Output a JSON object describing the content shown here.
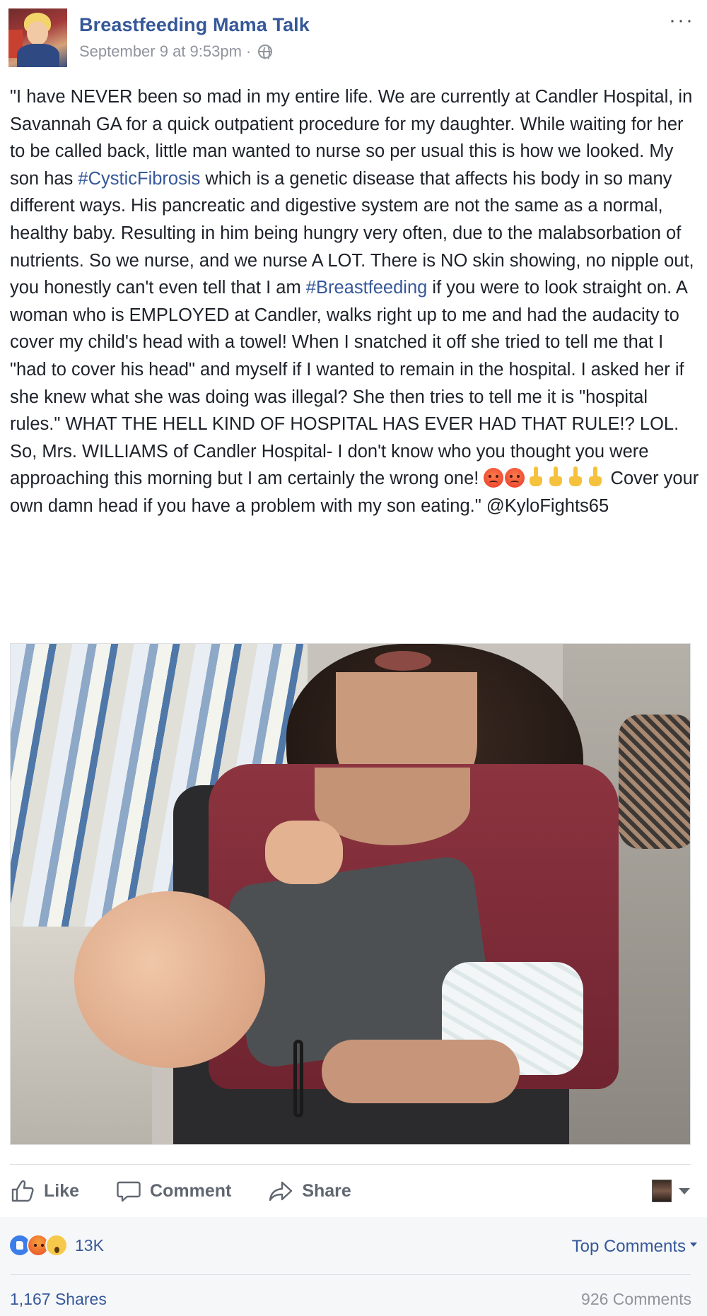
{
  "post": {
    "page_name": "Breastfeeding Mama Talk",
    "timestamp": "September 9 at 9:53pm",
    "separator": "·",
    "privacy_icon": "globe-icon",
    "more_icon": "ellipsis-icon",
    "text_segments": [
      {
        "type": "text",
        "value": "\"I have NEVER been so mad in my entire life. We are currently at Candler Hospital, in Savannah GA for a quick outpatient procedure for my daughter. While waiting for her to be called back, little man wanted to nurse so per usual this is how we looked. My son has "
      },
      {
        "type": "tag",
        "value": "#CysticFibrosis"
      },
      {
        "type": "text",
        "value": " which is a genetic disease that affects his body in so many different ways. His pancreatic and digestive system are not the same as a normal, healthy baby. Resulting in him being hungry very often, due to the malabsorbation of nutrients. So we nurse, and we nurse A LOT. There is NO skin showing, no nipple out, you honestly can't even tell that I am "
      },
      {
        "type": "tag",
        "value": "#Breastfeeding"
      },
      {
        "type": "text",
        "value": " if you were to look straight on. A woman who is EMPLOYED at Candler, walks right up to me and had the audacity to cover my child's head with a towel! When I snatched it off she tried to tell me that I \"had to cover his head\" and myself if I wanted to remain in the hospital. I asked her if she knew what she was doing was illegal? She then tries to tell me it is \"hospital rules.\" WHAT THE HELL KIND OF HOSPITAL HAS EVER HAD THAT RULE!? LOL. So, Mrs. WILLIAMS of Candler Hospital- I don't know who you thought you were approaching this morning but I am certainly the wrong one! "
      },
      {
        "type": "emoji",
        "value": "angry-face-emoji"
      },
      {
        "type": "emoji",
        "value": "angry-face-emoji"
      },
      {
        "type": "emoji",
        "value": "middle-finger-emoji"
      },
      {
        "type": "emoji",
        "value": "middle-finger-emoji"
      },
      {
        "type": "emoji",
        "value": "middle-finger-emoji"
      },
      {
        "type": "emoji",
        "value": "middle-finger-emoji"
      },
      {
        "type": "text",
        "value": " Cover your own damn head if you have a problem with my son eating.\" @KyloFights65"
      }
    ]
  },
  "actions": {
    "like_label": "Like",
    "comment_label": "Comment",
    "share_label": "Share"
  },
  "summary": {
    "reaction_icons": [
      "like",
      "angry",
      "wow"
    ],
    "reaction_count": "13K",
    "sort_label": "Top Comments",
    "shares_label": "1,167 Shares",
    "comments_label": "926 Comments"
  },
  "colors": {
    "link": "#365899",
    "muted": "#90949c",
    "text": "#1d2129"
  }
}
